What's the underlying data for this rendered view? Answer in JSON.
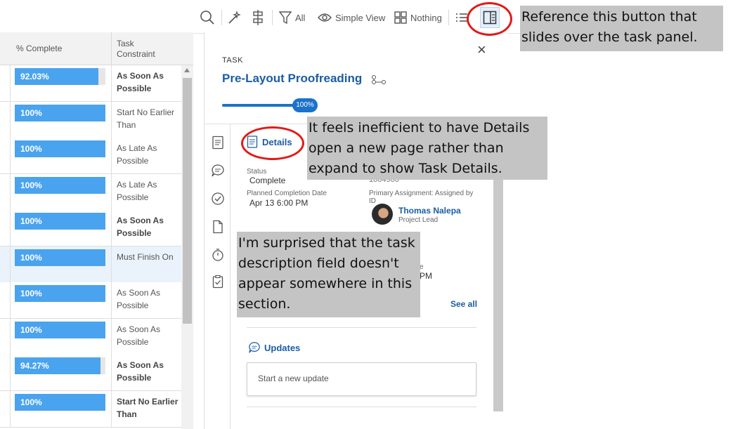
{
  "toolbar": {
    "filter_label": "All",
    "view_label": "Simple View",
    "group_label": "Nothing"
  },
  "table": {
    "headers": {
      "complete": "% Complete",
      "constraint": "Task Constraint"
    },
    "rows": [
      {
        "percent": "92.03%",
        "fill": 0.9203,
        "constraint": "As Soon As Possible",
        "bold": true,
        "selected": false
      },
      {
        "percent": "100%",
        "fill": 1,
        "constraint": "Start No Earlier Than",
        "bold": false,
        "selected": false
      },
      {
        "percent": "100%",
        "fill": 1,
        "constraint": "As Late As Possible",
        "bold": false,
        "selected": false
      },
      {
        "percent": "100%",
        "fill": 1,
        "constraint": "As Late As Possible",
        "bold": false,
        "selected": false
      },
      {
        "percent": "100%",
        "fill": 1,
        "constraint": "As Soon As Possible",
        "bold": true,
        "selected": false
      },
      {
        "percent": "100%",
        "fill": 1,
        "constraint": "Must Finish On",
        "bold": false,
        "selected": true
      },
      {
        "percent": "100%",
        "fill": 1,
        "constraint": "As Soon As Possible",
        "bold": false,
        "selected": false
      },
      {
        "percent": "100%",
        "fill": 1,
        "constraint": "As Soon As Possible",
        "bold": false,
        "selected": false
      },
      {
        "percent": "94.27%",
        "fill": 0.9427,
        "constraint": "As Soon As Possible",
        "bold": true,
        "selected": false
      },
      {
        "percent": "100%",
        "fill": 1,
        "constraint": "Start No Earlier Than",
        "bold": true,
        "selected": false
      }
    ]
  },
  "panel": {
    "kicker": "TASK",
    "title": "Pre-Layout Proofreading",
    "progress_label": "100%",
    "progress": 1,
    "close": "×",
    "details_label": "Details",
    "status_label": "Status",
    "status_value": "Complete",
    "id_partial": "1004900",
    "planned_label": "Planned Completion Date",
    "planned_value": "Apr 13 6:00 PM",
    "assign_label": "Primary Assignment: Assigned by ID",
    "person_name": "Thomas Nalepa",
    "person_role": "Project Lead",
    "partial_e": "e",
    "partial_pm": "PM",
    "see_all": "See all",
    "updates_label": "Updates",
    "update_placeholder": "Start a new update"
  },
  "annotations": {
    "button_note": "Reference this button that slides over the task panel.",
    "details_note": "It feels inefficient to have Details open a new page rather than expand to show Task Details.",
    "description_note": "I'm surprised that the task description field doesn't appear somewhere in this section."
  },
  "colors": {
    "accent": "#1a5da6",
    "progress": "#4aa3ee",
    "annotation_circle": "#e11a1a",
    "annotation_bg": "#c4c4c4"
  }
}
